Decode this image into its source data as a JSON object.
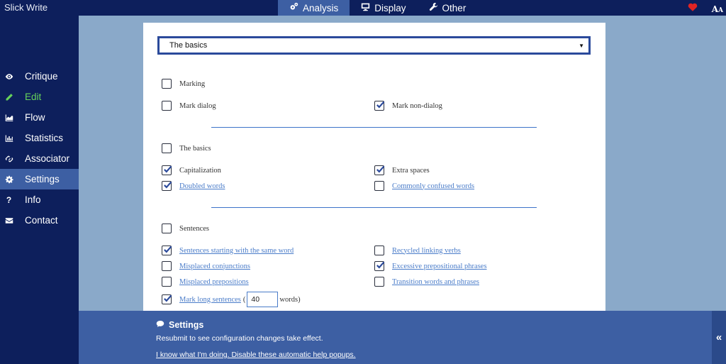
{
  "app": {
    "title": "Slick Write"
  },
  "topnav": {
    "tabs": [
      {
        "label": "Analysis",
        "icon": "gears-icon",
        "active": true
      },
      {
        "label": "Display",
        "icon": "monitor-icon",
        "active": false
      },
      {
        "label": "Other",
        "icon": "wrench-icon",
        "active": false
      }
    ],
    "right_icons": [
      "heart-icon",
      "font-size-icon"
    ],
    "font_size_glyph": "A",
    "font_size_glyph_small": "A"
  },
  "sidebar": {
    "items": [
      {
        "label": "Critique",
        "icon": "eye-icon"
      },
      {
        "label": "Edit",
        "icon": "pencil-icon",
        "highlight": "#66d25a"
      },
      {
        "label": "Flow",
        "icon": "area-chart-icon"
      },
      {
        "label": "Statistics",
        "icon": "bar-chart-icon"
      },
      {
        "label": "Associator",
        "icon": "link-icon"
      },
      {
        "label": "Settings",
        "icon": "gear-icon",
        "active": true
      },
      {
        "label": "Info",
        "icon": "question-icon",
        "glyph": "?"
      },
      {
        "label": "Contact",
        "icon": "envelope-icon"
      }
    ]
  },
  "main": {
    "preset_select": {
      "value": "The basics",
      "caret": "▼"
    },
    "groups": {
      "marking": {
        "label": "Marking",
        "checked": false,
        "items": [
          {
            "label": "Mark dialog",
            "checked": false,
            "link": false
          },
          {
            "label": "Mark non-dialog",
            "checked": true,
            "link": false
          }
        ]
      },
      "basics": {
        "label": "The basics",
        "checked": false,
        "items": [
          {
            "label": "Capitalization",
            "checked": true,
            "link": false
          },
          {
            "label": "Extra spaces",
            "checked": true,
            "link": false
          },
          {
            "label": "Doubled words",
            "checked": true,
            "link": true
          },
          {
            "label": "Commonly confused words",
            "checked": false,
            "link": true
          }
        ]
      },
      "sentences": {
        "label": "Sentences",
        "checked": false,
        "items": [
          {
            "label": "Sentences starting with the same word",
            "checked": true,
            "link": true
          },
          {
            "label": "Recycled linking verbs",
            "checked": false,
            "link": true
          },
          {
            "label": "Misplaced conjunctions",
            "checked": false,
            "link": true
          },
          {
            "label": "Excessive prepositional phrases",
            "checked": true,
            "link": true
          },
          {
            "label": "Misplaced prepositions",
            "checked": false,
            "link": true
          },
          {
            "label": "Transition words and phrases",
            "checked": false,
            "link": true
          }
        ],
        "long_sentences": {
          "label": "Mark long sentences",
          "checked": true,
          "open_paren": "(",
          "value": "40",
          "suffix": "words)"
        }
      }
    }
  },
  "help_popup": {
    "icon": "speech-bubble-icon",
    "title": "Settings",
    "text": "Resubmit to see configuration changes take effect.",
    "dismiss_link": "I know what I'm doing. Disable these automatic help popups.",
    "collapse_glyph": "«"
  },
  "colors": {
    "topbar": "#0d1f5c",
    "active_tab": "#3d5fa3",
    "background": "#8aa9c9",
    "accent_border": "#2b4a9b",
    "link": "#4a7cc9",
    "edit_green": "#66d25a",
    "heart": "#e02424"
  }
}
